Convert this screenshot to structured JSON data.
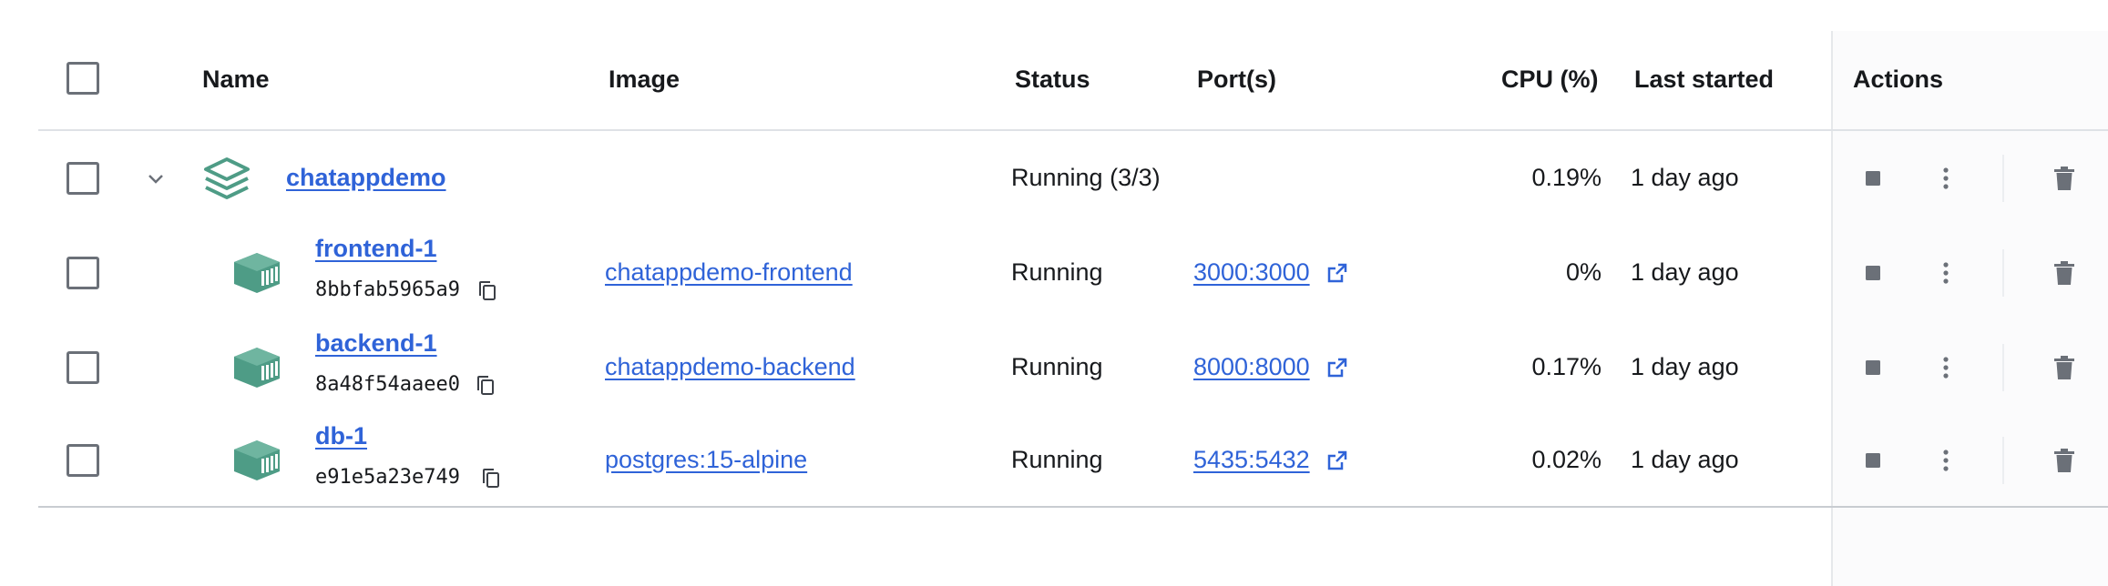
{
  "columns": {
    "name": "Name",
    "image": "Image",
    "status": "Status",
    "ports": "Port(s)",
    "cpu": "CPU (%)",
    "last_started": "Last started",
    "actions": "Actions"
  },
  "group": {
    "name": "chatappdemo",
    "status": "Running (3/3)",
    "cpu": "0.19%",
    "last_started": "1 day ago"
  },
  "containers": [
    {
      "name": "frontend-1",
      "id": "8bbfab5965a9",
      "image": "chatappdemo-frontend",
      "status": "Running",
      "ports": "3000:3000",
      "cpu": "0%",
      "last_started": "1 day ago"
    },
    {
      "name": "backend-1",
      "id": "8a48f54aaee0",
      "image": "chatappdemo-backend",
      "status": "Running",
      "ports": "8000:8000",
      "cpu": "0.17%",
      "last_started": "1 day ago"
    },
    {
      "name": "db-1",
      "id": "e91e5a23e749",
      "image": "postgres:15-alpine",
      "status": "Running",
      "ports": "5435:5432",
      "cpu": "0.02%",
      "last_started": "1 day ago"
    }
  ],
  "colors": {
    "link": "#2f63d8",
    "icon_green": "#4e9c86",
    "action_icon": "#6b7078"
  },
  "icons": {
    "expand": "chevron-down-icon",
    "group": "stack-layers-icon",
    "container": "container-icon",
    "copy": "copy-icon",
    "external": "external-link-icon",
    "stop": "stop-icon",
    "more": "more-vertical-icon",
    "delete": "trash-icon"
  }
}
